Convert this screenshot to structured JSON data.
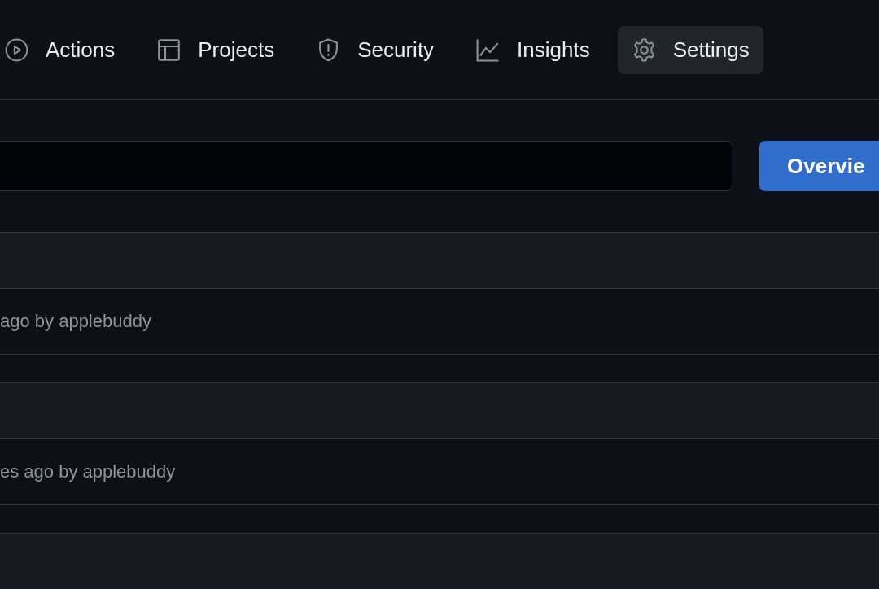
{
  "tabs": [
    {
      "label": "Actions",
      "selected": false
    },
    {
      "label": "Projects",
      "selected": false
    },
    {
      "label": "Security",
      "selected": false
    },
    {
      "label": "Insights",
      "selected": false
    },
    {
      "label": "Settings",
      "selected": true
    }
  ],
  "overview_button": "Overvie",
  "groups": [
    {
      "kind": "entry",
      "meta": "ago by applebuddy"
    },
    {
      "kind": "entry",
      "meta": "es ago by applebuddy"
    },
    {
      "kind": "header_only"
    }
  ]
}
